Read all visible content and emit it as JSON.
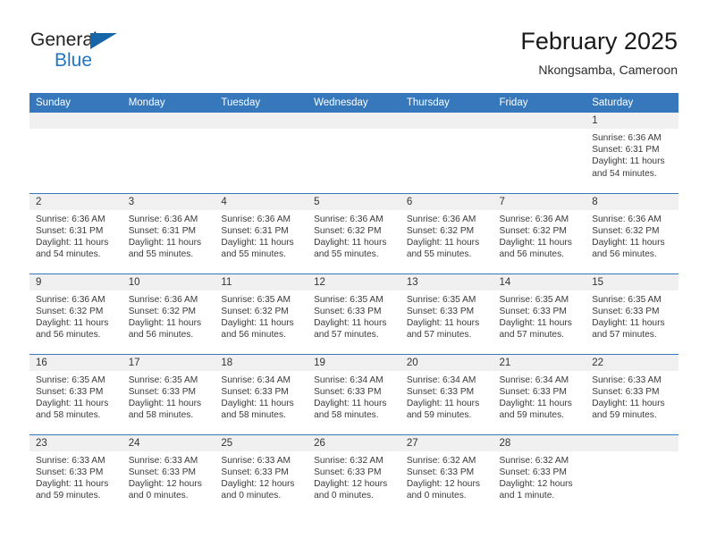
{
  "brand": {
    "line1": "General",
    "line2": "Blue",
    "triangle_color": "#1565a8",
    "blue_color": "#1f76c4"
  },
  "header": {
    "title": "February 2025",
    "subtitle": "Nkongsamba, Cameroon"
  },
  "theme": {
    "header_bg": "#3678bb",
    "header_text": "#ffffff",
    "daynum_band_bg": "#f0f0f0",
    "cell_bg": "#ffffff",
    "body_text": "#3a3a3a"
  },
  "weekdays": [
    "Sunday",
    "Monday",
    "Tuesday",
    "Wednesday",
    "Thursday",
    "Friday",
    "Saturday"
  ],
  "weeks": [
    [
      {
        "day": "",
        "empty": true
      },
      {
        "day": "",
        "empty": true
      },
      {
        "day": "",
        "empty": true
      },
      {
        "day": "",
        "empty": true
      },
      {
        "day": "",
        "empty": true
      },
      {
        "day": "",
        "empty": true
      },
      {
        "day": "1",
        "sunrise": "Sunrise: 6:36 AM",
        "sunset": "Sunset: 6:31 PM",
        "daylight1": "Daylight: 11 hours",
        "daylight2": "and 54 minutes."
      }
    ],
    [
      {
        "day": "2",
        "sunrise": "Sunrise: 6:36 AM",
        "sunset": "Sunset: 6:31 PM",
        "daylight1": "Daylight: 11 hours",
        "daylight2": "and 54 minutes."
      },
      {
        "day": "3",
        "sunrise": "Sunrise: 6:36 AM",
        "sunset": "Sunset: 6:31 PM",
        "daylight1": "Daylight: 11 hours",
        "daylight2": "and 55 minutes."
      },
      {
        "day": "4",
        "sunrise": "Sunrise: 6:36 AM",
        "sunset": "Sunset: 6:31 PM",
        "daylight1": "Daylight: 11 hours",
        "daylight2": "and 55 minutes."
      },
      {
        "day": "5",
        "sunrise": "Sunrise: 6:36 AM",
        "sunset": "Sunset: 6:32 PM",
        "daylight1": "Daylight: 11 hours",
        "daylight2": "and 55 minutes."
      },
      {
        "day": "6",
        "sunrise": "Sunrise: 6:36 AM",
        "sunset": "Sunset: 6:32 PM",
        "daylight1": "Daylight: 11 hours",
        "daylight2": "and 55 minutes."
      },
      {
        "day": "7",
        "sunrise": "Sunrise: 6:36 AM",
        "sunset": "Sunset: 6:32 PM",
        "daylight1": "Daylight: 11 hours",
        "daylight2": "and 56 minutes."
      },
      {
        "day": "8",
        "sunrise": "Sunrise: 6:36 AM",
        "sunset": "Sunset: 6:32 PM",
        "daylight1": "Daylight: 11 hours",
        "daylight2": "and 56 minutes."
      }
    ],
    [
      {
        "day": "9",
        "sunrise": "Sunrise: 6:36 AM",
        "sunset": "Sunset: 6:32 PM",
        "daylight1": "Daylight: 11 hours",
        "daylight2": "and 56 minutes."
      },
      {
        "day": "10",
        "sunrise": "Sunrise: 6:36 AM",
        "sunset": "Sunset: 6:32 PM",
        "daylight1": "Daylight: 11 hours",
        "daylight2": "and 56 minutes."
      },
      {
        "day": "11",
        "sunrise": "Sunrise: 6:35 AM",
        "sunset": "Sunset: 6:32 PM",
        "daylight1": "Daylight: 11 hours",
        "daylight2": "and 56 minutes."
      },
      {
        "day": "12",
        "sunrise": "Sunrise: 6:35 AM",
        "sunset": "Sunset: 6:33 PM",
        "daylight1": "Daylight: 11 hours",
        "daylight2": "and 57 minutes."
      },
      {
        "day": "13",
        "sunrise": "Sunrise: 6:35 AM",
        "sunset": "Sunset: 6:33 PM",
        "daylight1": "Daylight: 11 hours",
        "daylight2": "and 57 minutes."
      },
      {
        "day": "14",
        "sunrise": "Sunrise: 6:35 AM",
        "sunset": "Sunset: 6:33 PM",
        "daylight1": "Daylight: 11 hours",
        "daylight2": "and 57 minutes."
      },
      {
        "day": "15",
        "sunrise": "Sunrise: 6:35 AM",
        "sunset": "Sunset: 6:33 PM",
        "daylight1": "Daylight: 11 hours",
        "daylight2": "and 57 minutes."
      }
    ],
    [
      {
        "day": "16",
        "sunrise": "Sunrise: 6:35 AM",
        "sunset": "Sunset: 6:33 PM",
        "daylight1": "Daylight: 11 hours",
        "daylight2": "and 58 minutes."
      },
      {
        "day": "17",
        "sunrise": "Sunrise: 6:35 AM",
        "sunset": "Sunset: 6:33 PM",
        "daylight1": "Daylight: 11 hours",
        "daylight2": "and 58 minutes."
      },
      {
        "day": "18",
        "sunrise": "Sunrise: 6:34 AM",
        "sunset": "Sunset: 6:33 PM",
        "daylight1": "Daylight: 11 hours",
        "daylight2": "and 58 minutes."
      },
      {
        "day": "19",
        "sunrise": "Sunrise: 6:34 AM",
        "sunset": "Sunset: 6:33 PM",
        "daylight1": "Daylight: 11 hours",
        "daylight2": "and 58 minutes."
      },
      {
        "day": "20",
        "sunrise": "Sunrise: 6:34 AM",
        "sunset": "Sunset: 6:33 PM",
        "daylight1": "Daylight: 11 hours",
        "daylight2": "and 59 minutes."
      },
      {
        "day": "21",
        "sunrise": "Sunrise: 6:34 AM",
        "sunset": "Sunset: 6:33 PM",
        "daylight1": "Daylight: 11 hours",
        "daylight2": "and 59 minutes."
      },
      {
        "day": "22",
        "sunrise": "Sunrise: 6:33 AM",
        "sunset": "Sunset: 6:33 PM",
        "daylight1": "Daylight: 11 hours",
        "daylight2": "and 59 minutes."
      }
    ],
    [
      {
        "day": "23",
        "sunrise": "Sunrise: 6:33 AM",
        "sunset": "Sunset: 6:33 PM",
        "daylight1": "Daylight: 11 hours",
        "daylight2": "and 59 minutes."
      },
      {
        "day": "24",
        "sunrise": "Sunrise: 6:33 AM",
        "sunset": "Sunset: 6:33 PM",
        "daylight1": "Daylight: 12 hours",
        "daylight2": "and 0 minutes."
      },
      {
        "day": "25",
        "sunrise": "Sunrise: 6:33 AM",
        "sunset": "Sunset: 6:33 PM",
        "daylight1": "Daylight: 12 hours",
        "daylight2": "and 0 minutes."
      },
      {
        "day": "26",
        "sunrise": "Sunrise: 6:32 AM",
        "sunset": "Sunset: 6:33 PM",
        "daylight1": "Daylight: 12 hours",
        "daylight2": "and 0 minutes."
      },
      {
        "day": "27",
        "sunrise": "Sunrise: 6:32 AM",
        "sunset": "Sunset: 6:33 PM",
        "daylight1": "Daylight: 12 hours",
        "daylight2": "and 0 minutes."
      },
      {
        "day": "28",
        "sunrise": "Sunrise: 6:32 AM",
        "sunset": "Sunset: 6:33 PM",
        "daylight1": "Daylight: 12 hours",
        "daylight2": "and 1 minute."
      },
      {
        "day": "",
        "empty": true
      }
    ]
  ]
}
